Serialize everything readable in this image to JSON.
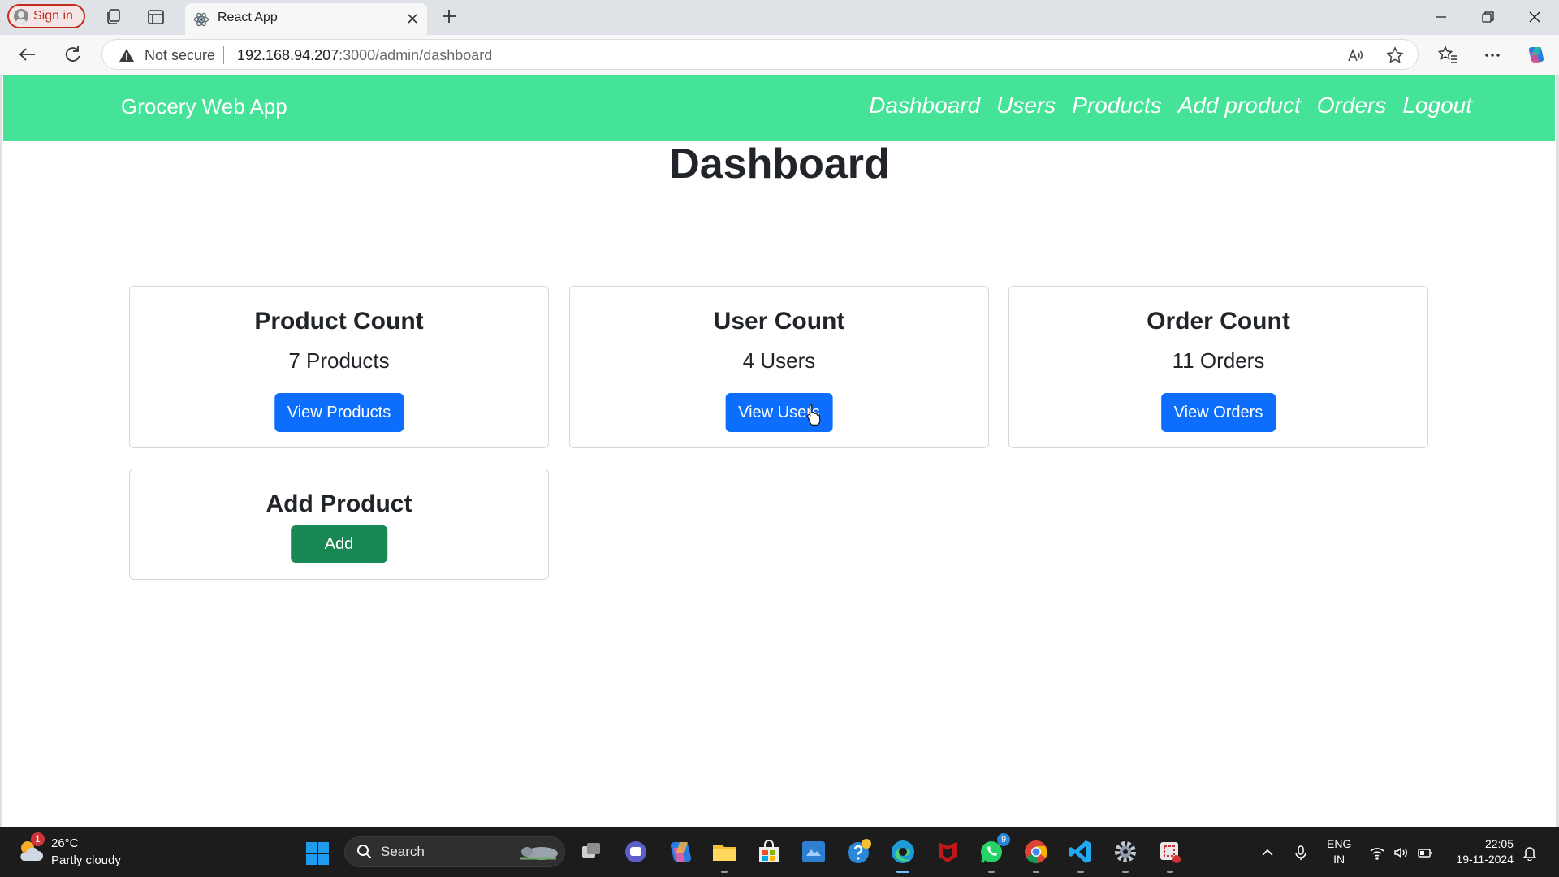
{
  "browser": {
    "profile_label": "Sign in",
    "tab_title": "React App",
    "security_label": "Not secure",
    "url_host": "192.168.94.207",
    "url_rest": ":3000/admin/dashboard"
  },
  "app": {
    "brand": "Grocery Web App",
    "nav": [
      "Dashboard",
      "Users",
      "Products",
      "Add product",
      "Orders",
      "Logout"
    ],
    "page_title": "Dashboard",
    "cards": [
      {
        "title": "Product Count",
        "count": "7 Products",
        "button": "View Products"
      },
      {
        "title": "User Count",
        "count": "4 Users",
        "button": "View Users"
      },
      {
        "title": "Order Count",
        "count": "11 Orders",
        "button": "View Orders"
      },
      {
        "title": "Add Product",
        "button": "Add"
      }
    ],
    "colors": {
      "navbar": "#44e398",
      "primary": "#0d6efd",
      "success": "#198754"
    }
  },
  "taskbar": {
    "weather_badge": "1",
    "weather_temp": "26°C",
    "weather_desc": "Partly cloudy",
    "search_placeholder": "Search",
    "whatsapp_badge": "9",
    "lang_line1": "ENG",
    "lang_line2": "IN",
    "time": "22:05",
    "date": "19-11-2024"
  }
}
